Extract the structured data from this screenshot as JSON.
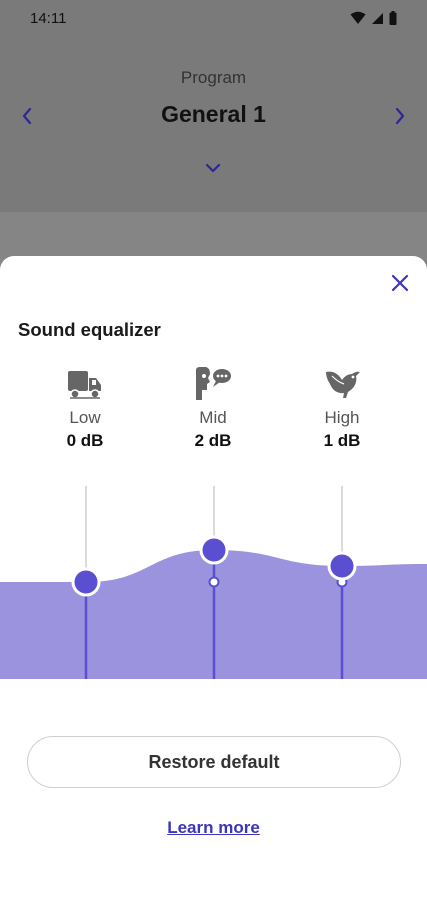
{
  "status_bar": {
    "time": "14:11"
  },
  "program": {
    "label": "Program",
    "name": "General 1"
  },
  "sheet": {
    "title": "Sound equalizer",
    "bands": [
      {
        "name": "Low",
        "value": "0 dB",
        "icon": "truck-icon",
        "level_db": 0
      },
      {
        "name": "Mid",
        "value": "2 dB",
        "icon": "speaking-person-icon",
        "level_db": 2
      },
      {
        "name": "High",
        "value": "1 dB",
        "icon": "bird-icon",
        "level_db": 1
      }
    ],
    "restore_label": "Restore default",
    "learn_more_label": "Learn more"
  },
  "colors": {
    "accent": "#3d35b8",
    "knob": "#5a4fd0",
    "fill": "#9b93de",
    "backdrop": "#7a7a7a"
  }
}
